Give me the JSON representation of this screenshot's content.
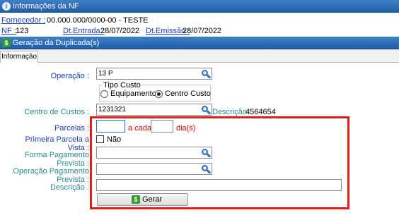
{
  "nf_window": {
    "title": "Informações da NF",
    "fornecedor_label": "Fornecedor :",
    "fornecedor_value": "00.000.000/0000-00 - TESTE",
    "nf_label": "NF :",
    "nf_value": "123",
    "dt_entrada_label": "Dt.Entrada :",
    "dt_entrada_value": "28/07/2022",
    "dt_emissao_label": "Dt.Emissão :",
    "dt_emissao_value": "28/07/2022"
  },
  "dup_window": {
    "title": "Geração da Duplicada(s)",
    "tab_label": "Informação"
  },
  "form": {
    "operacao_label": "Operação :",
    "operacao_value": "13 P",
    "tipo_custo_legend": "Tipo Custo",
    "tipo_custo_options": [
      "Equipamento",
      "Centro Custo"
    ],
    "tipo_custo_selected": "Centro Custo",
    "centro_custos_label": "Centro de Custos :",
    "centro_custos_value": "1231321",
    "descricao_cc_label": "Descrição :",
    "descricao_cc_value": "4564654",
    "parcelas_label": "Parcelas :",
    "parcelas_value": "",
    "a_cada_label": "a cada",
    "dias_value": "",
    "dias_label": "dia(s)",
    "primeira_parcela_label": "Primeira Parcela a Vista :",
    "primeira_parcela_check_label": "Não",
    "primeira_parcela_checked": false,
    "forma_pagamento_label": "Forma Pagamento Prevista :",
    "forma_pagamento_value": "",
    "operacao_pagamento_label": "Operação Pagamento Prevista :",
    "operacao_pagamento_value": "",
    "descricao_label": "Descrição :",
    "descricao_value": "",
    "gerar_label": "Gerar"
  },
  "colors": {
    "title_bar": "#1f5ea8",
    "label_blue": "#1a3db8",
    "label_teal": "#2a8a8f",
    "label_red": "#e00000",
    "highlight_box": "#e41b1b"
  }
}
